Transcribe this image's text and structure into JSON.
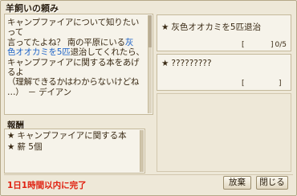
{
  "window": {
    "title": "羊飼いの頼み"
  },
  "story": {
    "line1": "キャンプファイアについて知りたいって",
    "line2a": "言ってたよね？ 南の平原にいる",
    "line2b": "灰",
    "line3a": "色オオカミを5匹",
    "line3b": "退治してくれたら、",
    "line4": "キャンプファイアに関する本をあげるよ",
    "line5": "（理解できるかはわからないけどね",
    "line6": "…）　－ デイアン"
  },
  "quests": [
    {
      "text": "灰色オオカミを5匹退治",
      "progress": "0/5",
      "bracket_left": "[",
      "bracket_right": "]"
    },
    {
      "text": "?????????",
      "progress": "",
      "bracket_left": "[",
      "bracket_right": "]"
    }
  ],
  "reward": {
    "heading": "報酬",
    "items": [
      {
        "text": "キャンプファイアに関する本"
      },
      {
        "text": "薪 5個"
      }
    ]
  },
  "deadline": "1日1時間以内に完了",
  "buttons": {
    "abandon": "放棄",
    "close": "閉じる"
  },
  "icons": {
    "bullet": "★"
  },
  "colors": {
    "deadline": "#e02010",
    "highlight": "#1f64c8"
  }
}
